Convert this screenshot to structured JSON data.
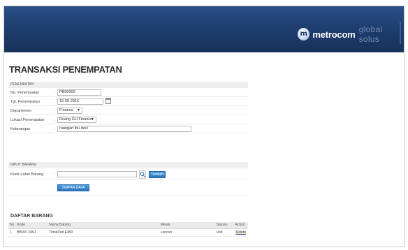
{
  "brand": {
    "logo_glyph": "m",
    "name": "metrocom",
    "tagline": "global solus"
  },
  "page": {
    "title": "TRANSAKSI PENEMPATAN"
  },
  "penempatan": {
    "heading": "PENEMPATAN",
    "no_label": "No. Penempatan",
    "no_value": "PB00002",
    "tgl_label": "Tgl. Penempatan",
    "tgl_value": "15-05-2016",
    "dept_label": "Departemen",
    "dept_value": "Finance",
    "lokasi_label": "Lokasi Penempatan",
    "lokasi_value": "Ruang GH Finance",
    "ket_label": "Keterangan",
    "ket_value": "ruangan ibu devi",
    "colon": ":"
  },
  "input_barang": {
    "heading": "INPUT BARANG",
    "kode_label": "Kode Label Barang",
    "kode_value": "",
    "add_button": "Tambah",
    "colon": ":"
  },
  "save_button": "SIMPAN DATA",
  "daftar": {
    "title": "DAFTAR BARANG",
    "columns": [
      "No",
      "Kode",
      "Nama Barang",
      "Merek",
      "Satuan",
      "Action"
    ],
    "rows": [
      {
        "no": "1",
        "kode": "BB007.0001",
        "nama": "ThinkPad E450",
        "merek": "Lenovo",
        "satuan": "Unit",
        "action": "Delete"
      }
    ]
  },
  "colors": {
    "header_bg": "#1d3b6b",
    "button_blue": "#2a74bd",
    "link": "#1a3fb0"
  }
}
